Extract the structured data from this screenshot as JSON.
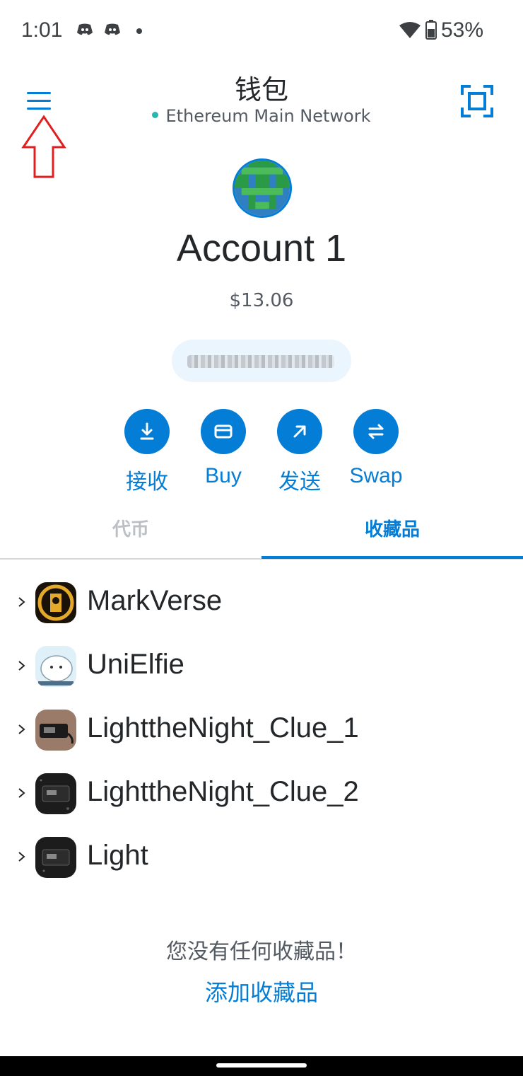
{
  "status_bar": {
    "time": "1:01",
    "battery": "53%",
    "icons": [
      "discord-icon",
      "discord-icon",
      "dot",
      "wifi-icon",
      "battery-icon"
    ]
  },
  "header": {
    "title": "钱包",
    "network": "Ethereum Main Network",
    "menu_icon": "hamburger-menu-icon",
    "scan_icon": "qr-scan-icon",
    "annotation": "red-outline-up-arrow"
  },
  "account": {
    "name": "Account 1",
    "balance": "$13.06",
    "address": "(obscured)"
  },
  "actions": [
    {
      "label": "接收",
      "icon": "download-icon"
    },
    {
      "label": "Buy",
      "icon": "card-icon"
    },
    {
      "label": "发送",
      "icon": "arrow-up-right-icon"
    },
    {
      "label": "Swap",
      "icon": "swap-icon"
    }
  ],
  "tabs": {
    "tokens": "代币",
    "collectibles": "收藏品",
    "active": "collectibles"
  },
  "collectibles": [
    {
      "name": "MarkVerse"
    },
    {
      "name": "UniElfie"
    },
    {
      "name": "LighttheNight_Clue_1"
    },
    {
      "name": "LighttheNight_Clue_2"
    },
    {
      "name": "Light"
    }
  ],
  "empty_state": {
    "message": "您没有任何收藏品！",
    "add_link": "添加收藏品"
  },
  "colors": {
    "accent": "#037dd6",
    "network_dot": "#29b6af",
    "annotation_red": "#e02020"
  }
}
